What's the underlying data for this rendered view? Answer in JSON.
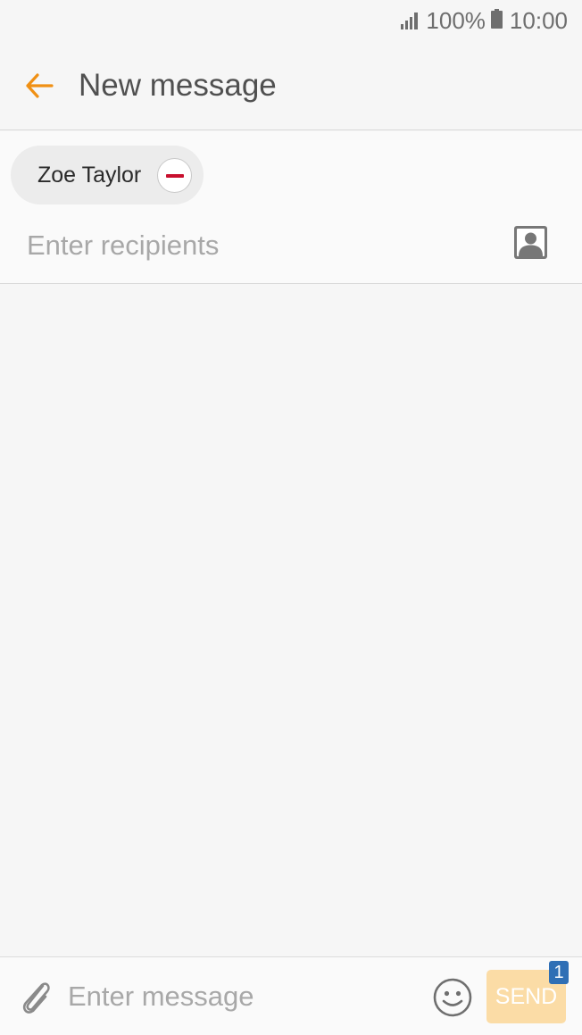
{
  "status_bar": {
    "battery": "100%",
    "time": "10:00",
    "icons": [
      "signal-icon",
      "battery-icon"
    ]
  },
  "app_bar": {
    "back_icon": "back-arrow-icon",
    "title": "New message",
    "accent_color": "#f09014"
  },
  "recipients": {
    "chips": [
      {
        "label": "Zoe Taylor",
        "remove_icon": "remove-icon",
        "remove_color": "#c8102e"
      }
    ],
    "input_placeholder": "Enter recipients",
    "contacts_icon": "contact-icon"
  },
  "composer": {
    "attach_icon": "paperclip-icon",
    "message_placeholder": "Enter message",
    "emoji_icon": "smiley-icon",
    "send_label": "SEND",
    "sim_badge": "1",
    "send_color": "#fbdca6",
    "badge_color": "#2f6fb5"
  }
}
